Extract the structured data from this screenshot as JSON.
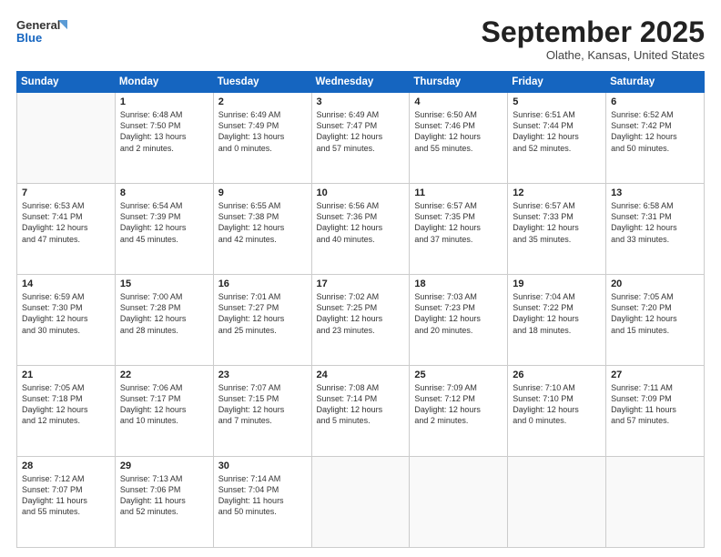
{
  "header": {
    "logo_line1": "General",
    "logo_line2": "Blue",
    "month": "September 2025",
    "location": "Olathe, Kansas, United States"
  },
  "weekdays": [
    "Sunday",
    "Monday",
    "Tuesday",
    "Wednesday",
    "Thursday",
    "Friday",
    "Saturday"
  ],
  "weeks": [
    [
      {
        "day": "",
        "info": ""
      },
      {
        "day": "1",
        "info": "Sunrise: 6:48 AM\nSunset: 7:50 PM\nDaylight: 13 hours\nand 2 minutes."
      },
      {
        "day": "2",
        "info": "Sunrise: 6:49 AM\nSunset: 7:49 PM\nDaylight: 13 hours\nand 0 minutes."
      },
      {
        "day": "3",
        "info": "Sunrise: 6:49 AM\nSunset: 7:47 PM\nDaylight: 12 hours\nand 57 minutes."
      },
      {
        "day": "4",
        "info": "Sunrise: 6:50 AM\nSunset: 7:46 PM\nDaylight: 12 hours\nand 55 minutes."
      },
      {
        "day": "5",
        "info": "Sunrise: 6:51 AM\nSunset: 7:44 PM\nDaylight: 12 hours\nand 52 minutes."
      },
      {
        "day": "6",
        "info": "Sunrise: 6:52 AM\nSunset: 7:42 PM\nDaylight: 12 hours\nand 50 minutes."
      }
    ],
    [
      {
        "day": "7",
        "info": "Sunrise: 6:53 AM\nSunset: 7:41 PM\nDaylight: 12 hours\nand 47 minutes."
      },
      {
        "day": "8",
        "info": "Sunrise: 6:54 AM\nSunset: 7:39 PM\nDaylight: 12 hours\nand 45 minutes."
      },
      {
        "day": "9",
        "info": "Sunrise: 6:55 AM\nSunset: 7:38 PM\nDaylight: 12 hours\nand 42 minutes."
      },
      {
        "day": "10",
        "info": "Sunrise: 6:56 AM\nSunset: 7:36 PM\nDaylight: 12 hours\nand 40 minutes."
      },
      {
        "day": "11",
        "info": "Sunrise: 6:57 AM\nSunset: 7:35 PM\nDaylight: 12 hours\nand 37 minutes."
      },
      {
        "day": "12",
        "info": "Sunrise: 6:57 AM\nSunset: 7:33 PM\nDaylight: 12 hours\nand 35 minutes."
      },
      {
        "day": "13",
        "info": "Sunrise: 6:58 AM\nSunset: 7:31 PM\nDaylight: 12 hours\nand 33 minutes."
      }
    ],
    [
      {
        "day": "14",
        "info": "Sunrise: 6:59 AM\nSunset: 7:30 PM\nDaylight: 12 hours\nand 30 minutes."
      },
      {
        "day": "15",
        "info": "Sunrise: 7:00 AM\nSunset: 7:28 PM\nDaylight: 12 hours\nand 28 minutes."
      },
      {
        "day": "16",
        "info": "Sunrise: 7:01 AM\nSunset: 7:27 PM\nDaylight: 12 hours\nand 25 minutes."
      },
      {
        "day": "17",
        "info": "Sunrise: 7:02 AM\nSunset: 7:25 PM\nDaylight: 12 hours\nand 23 minutes."
      },
      {
        "day": "18",
        "info": "Sunrise: 7:03 AM\nSunset: 7:23 PM\nDaylight: 12 hours\nand 20 minutes."
      },
      {
        "day": "19",
        "info": "Sunrise: 7:04 AM\nSunset: 7:22 PM\nDaylight: 12 hours\nand 18 minutes."
      },
      {
        "day": "20",
        "info": "Sunrise: 7:05 AM\nSunset: 7:20 PM\nDaylight: 12 hours\nand 15 minutes."
      }
    ],
    [
      {
        "day": "21",
        "info": "Sunrise: 7:05 AM\nSunset: 7:18 PM\nDaylight: 12 hours\nand 12 minutes."
      },
      {
        "day": "22",
        "info": "Sunrise: 7:06 AM\nSunset: 7:17 PM\nDaylight: 12 hours\nand 10 minutes."
      },
      {
        "day": "23",
        "info": "Sunrise: 7:07 AM\nSunset: 7:15 PM\nDaylight: 12 hours\nand 7 minutes."
      },
      {
        "day": "24",
        "info": "Sunrise: 7:08 AM\nSunset: 7:14 PM\nDaylight: 12 hours\nand 5 minutes."
      },
      {
        "day": "25",
        "info": "Sunrise: 7:09 AM\nSunset: 7:12 PM\nDaylight: 12 hours\nand 2 minutes."
      },
      {
        "day": "26",
        "info": "Sunrise: 7:10 AM\nSunset: 7:10 PM\nDaylight: 12 hours\nand 0 minutes."
      },
      {
        "day": "27",
        "info": "Sunrise: 7:11 AM\nSunset: 7:09 PM\nDaylight: 11 hours\nand 57 minutes."
      }
    ],
    [
      {
        "day": "28",
        "info": "Sunrise: 7:12 AM\nSunset: 7:07 PM\nDaylight: 11 hours\nand 55 minutes."
      },
      {
        "day": "29",
        "info": "Sunrise: 7:13 AM\nSunset: 7:06 PM\nDaylight: 11 hours\nand 52 minutes."
      },
      {
        "day": "30",
        "info": "Sunrise: 7:14 AM\nSunset: 7:04 PM\nDaylight: 11 hours\nand 50 minutes."
      },
      {
        "day": "",
        "info": ""
      },
      {
        "day": "",
        "info": ""
      },
      {
        "day": "",
        "info": ""
      },
      {
        "day": "",
        "info": ""
      }
    ]
  ]
}
